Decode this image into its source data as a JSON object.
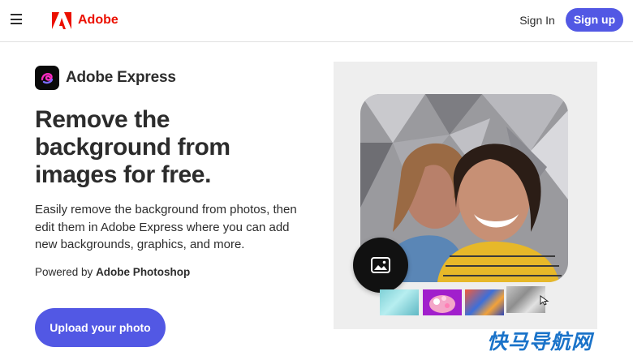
{
  "header": {
    "brand": "Adobe",
    "signin_label": "Sign In",
    "signup_label": "Sign up"
  },
  "hero": {
    "product_name": "Adobe Express",
    "title_lines": [
      "Remove the",
      "background from",
      "images for free."
    ],
    "description": "Easily remove the background from photos, then edit them in Adobe Express where you can add new backgrounds, graphics, and more.",
    "powered_prefix": "Powered by",
    "powered_product": "Adobe Photoshop",
    "cta_label": "Upload your photo"
  },
  "demo": {
    "thumbnails": [
      "teal-abstract",
      "pink-flowers",
      "colorful-paint",
      "gray-crystals"
    ]
  },
  "watermark": "快马导航网",
  "colors": {
    "accent": "#5258e4",
    "adobe_red": "#eb1000",
    "panel_bg": "#eeeeee"
  }
}
